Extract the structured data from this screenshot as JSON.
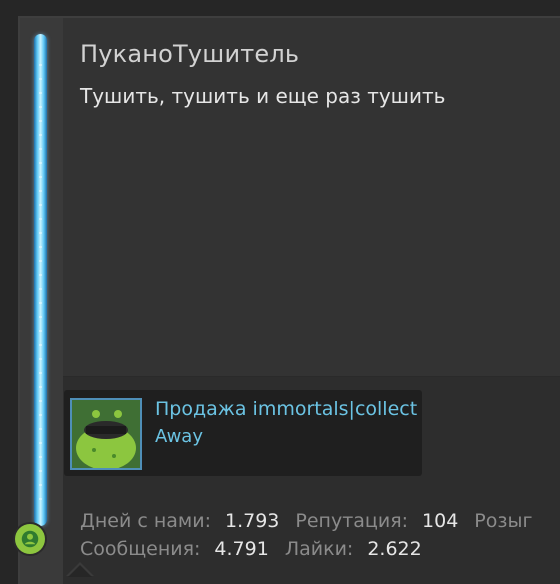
{
  "profile": {
    "username": "ПуканоТушитель",
    "status_message": "Тушить, тушить и еще раз тушить"
  },
  "card": {
    "title": "Продажа immortals|collect",
    "subtitle": "Away"
  },
  "stats": {
    "days_label": "Дней с нами:",
    "days_value": "1.793",
    "rep_label": "Репутация:",
    "rep_value": "104",
    "extra_label": "Розыг",
    "messages_label": "Сообщения:",
    "messages_value": "4.791",
    "likes_label": "Лайки:",
    "likes_value": "2.622"
  },
  "colors": {
    "accent_link": "#6bc3e3",
    "online_status": "#8dc63f",
    "glow_bar": "#5fc8f5"
  },
  "icons": {
    "status": "user-icon",
    "sidebar_bar": "glow-bar"
  }
}
